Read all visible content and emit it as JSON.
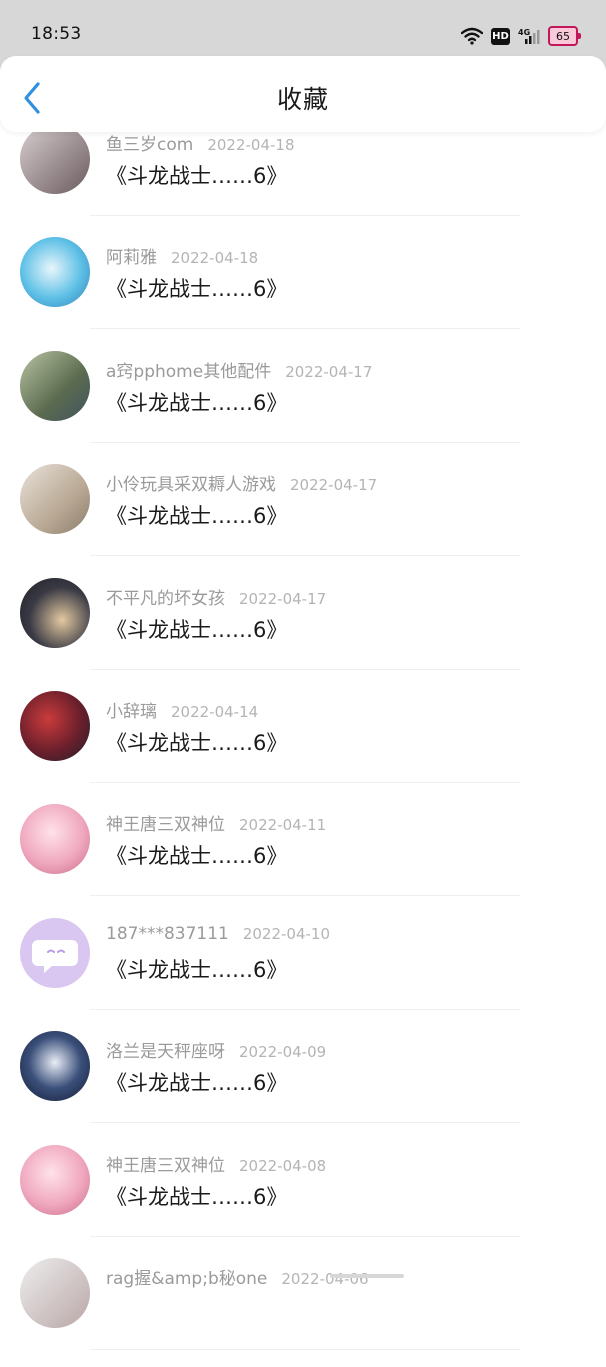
{
  "status_bar": {
    "time": "18:53",
    "battery": "65",
    "hd": "HD",
    "network": "4G"
  },
  "header": {
    "title": "收藏"
  },
  "items": [
    {
      "name": "鱼三岁com",
      "date": "2022-04-18",
      "text": "《斗龙战士……6》",
      "avatar_bg": "linear-gradient(135deg,#d8cfd0,#6b5b5e)"
    },
    {
      "name": "阿莉雅",
      "date": "2022-04-18",
      "text": "《斗龙战士……6》",
      "avatar_bg": "radial-gradient(circle at 45% 45%,#e8f6fb,#5ec0e6 55%,#2f7fb4)"
    },
    {
      "name": "a窍pphome其他配件",
      "date": "2022-04-17",
      "text": "《斗龙战士……6》",
      "avatar_bg": "linear-gradient(135deg,#b9c3a2,#5b6b4f 60%,#3f5360)"
    },
    {
      "name": "小伶玩具采双耨人游戏",
      "date": "2022-04-17",
      "text": "《斗龙战士……6》",
      "avatar_bg": "linear-gradient(135deg,#e9e2da,#b9a995 60%,#8c7c6c)"
    },
    {
      "name": "不平凡的坏女孩",
      "date": "2022-04-17",
      "text": "《斗龙战士……6》",
      "avatar_bg": "radial-gradient(circle at 60% 60%,#e3c9a0,#3a3a45 55%,#1c1c22)"
    },
    {
      "name": "小辞璃",
      "date": "2022-04-14",
      "text": "《斗龙战士……6》",
      "avatar_bg": "radial-gradient(circle at 40% 40%,#c93b3b,#6b1f2c 55%,#1f1f2e)"
    },
    {
      "name": "神王唐三双神位",
      "date": "2022-04-11",
      "text": "《斗龙战士……6》",
      "avatar_bg": "radial-gradient(circle at 45% 40%,#ffe2ea,#f0a8bf 55%,#c86a86)"
    },
    {
      "name": "187***837111",
      "date": "2022-04-10",
      "text": "《斗龙战士……6》",
      "avatar_bg": "#d9c6f1"
    },
    {
      "name": "洛兰是天秤座呀",
      "date": "2022-04-09",
      "text": "《斗龙战士……6》",
      "avatar_bg": "radial-gradient(circle at 50% 45%,#e9eef6,#3a4f7a 50%,#141b33)"
    },
    {
      "name": "神王唐三双神位",
      "date": "2022-04-08",
      "text": "《斗龙战士……6》",
      "avatar_bg": "radial-gradient(circle at 45% 40%,#ffe2ea,#f0a8bf 55%,#c86a86)"
    },
    {
      "name": "rag握&amp;b秘one",
      "date": "2022-04-06",
      "text": "",
      "avatar_bg": "linear-gradient(135deg,#eee,#b9a6a6)"
    }
  ]
}
